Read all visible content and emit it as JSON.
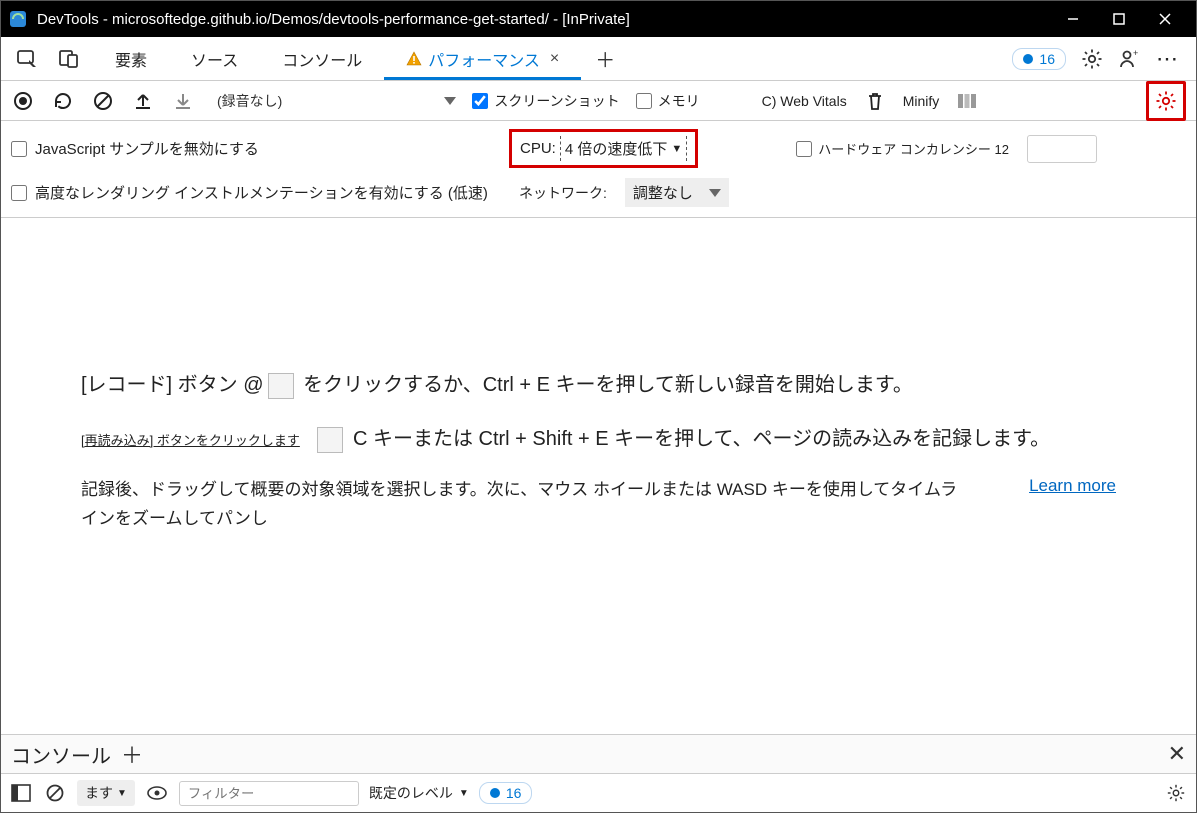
{
  "window": {
    "title": "DevTools - microsoftedge.github.io/Demos/devtools-performance-get-started/ - [InPrivate]"
  },
  "tabs": {
    "elements": "要素",
    "sources": "ソース",
    "console": "コンソール",
    "performance": "パフォーマンス"
  },
  "topright": {
    "issue_count": "16"
  },
  "toolbar": {
    "status": "(録音なし)",
    "screenshot": "スクリーンショット",
    "memory": "メモリ",
    "web_vitals": "C) Web Vitals",
    "minify": "Minify"
  },
  "opts": {
    "disable_js_samples": "JavaScript サンプルを無効にする",
    "cpu_label": "CPU:",
    "cpu_value": "4 倍の速度低下",
    "hw_label": "ハードウェア コンカレンシー 12",
    "advanced_rendering": "高度なレンダリング インストルメンテーションを有効にする (低速)",
    "net_label": "ネットワーク:",
    "net_value": "調整なし"
  },
  "panel": {
    "line1a": "[レコード] ボタン ",
    "line1b": " をクリックするか、Ctrl + E キーを押して新しい録音を開始します。",
    "line2_small": "[再読み込み] ボタンをクリックします",
    "line2b": " C キーまたは Ctrl + Shift + E キーを押して、ページの読み込みを記録します。",
    "line3": "記録後、ドラッグして概要の対象領域を選択します。次に、マウス ホイールまたは WASD キーを使用してタイムラインをズームしてパンし",
    "learn_more": "Learn more"
  },
  "drawer": {
    "title": "コンソール",
    "context": "ます",
    "filter_placeholder": "フィルター",
    "level": "既定のレベル",
    "issue_count": "16"
  }
}
